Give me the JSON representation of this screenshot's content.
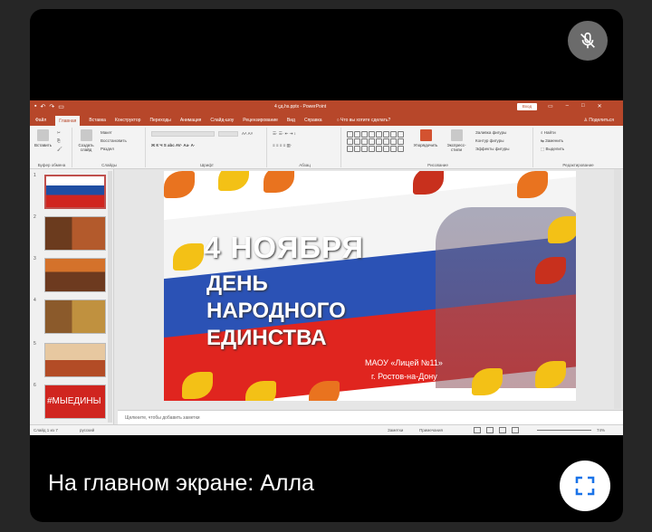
{
  "caption": "На главном экране: Алла",
  "icons": {
    "mic": "mic-off-icon",
    "fullscreen": "fullscreen-icon"
  },
  "ppt": {
    "doc_title": "4 ҫд.hs.pptx - PowerPoint",
    "signin": "Вход",
    "menu": [
      "Файл",
      "Главная",
      "Вставка",
      "Конструктор",
      "Переходы",
      "Анимация",
      "Слайд-шоу",
      "Рецензирование",
      "Вид",
      "Справка"
    ],
    "active_tab": "Главная",
    "tell_me": "Что вы хотите сделать?",
    "share": "Поделиться",
    "ribbon": {
      "paste": "Вставить",
      "clipboard": "Буфер обмена",
      "new_slide": "Создать слайд",
      "layout": "Макет",
      "reset": "Восстановить",
      "section": "Раздел",
      "slides": "Слайды",
      "font": "Шрифт",
      "paragraph": "Абзац",
      "arrange": "Упорядочить",
      "quick_styles": "Экспресс-стили",
      "fill": "Заливка фигуры",
      "outline": "Контур фигуры",
      "effects": "Эффекты фигуры",
      "drawing": "Рисование",
      "find": "Найти",
      "replace": "Заменить",
      "select": "Выделить",
      "editing": "Редактирование"
    },
    "thumbnails": [
      {
        "num": "1",
        "text": ""
      },
      {
        "num": "2",
        "text": ""
      },
      {
        "num": "3",
        "text": ""
      },
      {
        "num": "4",
        "text": ""
      },
      {
        "num": "5",
        "text": ""
      },
      {
        "num": "6",
        "text": "#МЫЕДИНЫ"
      }
    ],
    "slide": {
      "title": "4 НОЯБРЯ",
      "subtitle_1": "ДЕНЬ",
      "subtitle_2": "НАРОДНОГО",
      "subtitle_3": "ЕДИНСТВА",
      "school": "МАОУ «Лицей №11»",
      "city": "г. Ростов-на-Дону"
    },
    "notes_placeholder": "Щелкните, чтобы добавить заметки",
    "status": {
      "slide_counter": "Слайд 1 из 7",
      "language": "русский",
      "notes": "Заметки",
      "comments": "Примечания",
      "zoom": "74%"
    }
  }
}
